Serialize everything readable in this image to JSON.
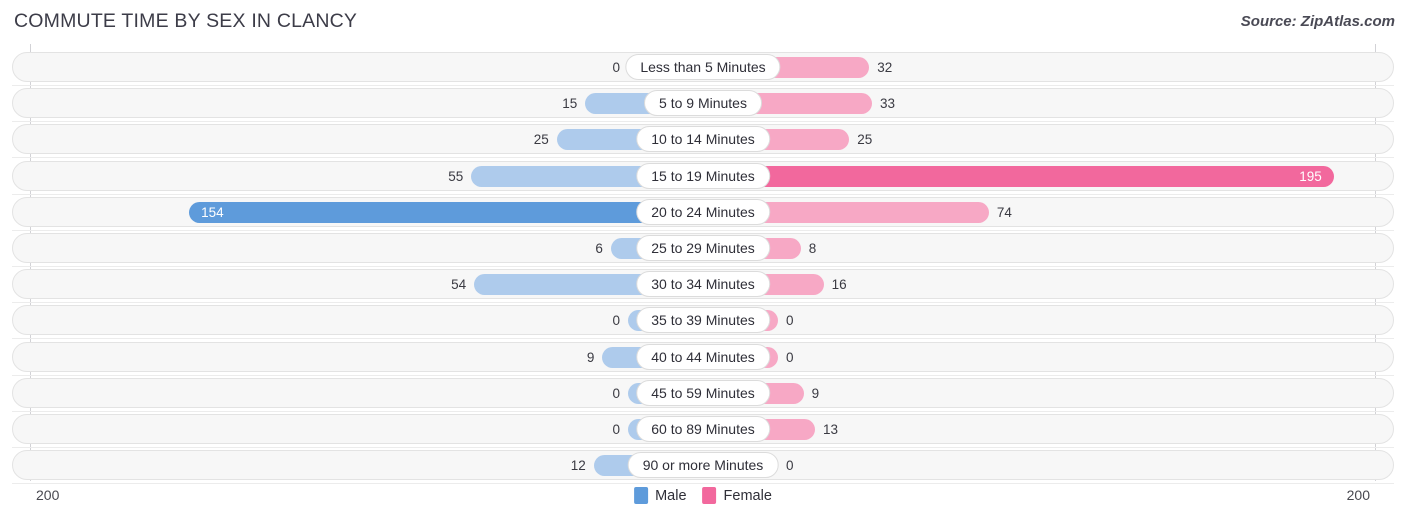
{
  "header": {
    "title": "COMMUTE TIME BY SEX IN CLANCY",
    "source": "Source: ZipAtlas.com"
  },
  "legend": {
    "male_label": "Male",
    "female_label": "Female",
    "male_color": "#5e9bdb",
    "female_color": "#f2689d"
  },
  "axis": {
    "left_tick": "200",
    "right_tick": "200",
    "max": 200
  },
  "colors": {
    "male_light": "#aecbec",
    "male_dark": "#5e9bdb",
    "female_light": "#f7a8c5",
    "female_dark": "#f2689d",
    "track": "#f7f7f7",
    "title": "#3c3c48"
  },
  "chart_data": {
    "type": "bar",
    "title": "COMMUTE TIME BY SEX IN CLANCY",
    "subtitle": "Source: ZipAtlas.com",
    "orientation": "horizontal-diverging",
    "xlabel": "",
    "ylabel": "",
    "xlim": [
      200,
      200
    ],
    "grid": false,
    "legend_position": "bottom-center",
    "categories": [
      "Less than 5 Minutes",
      "5 to 9 Minutes",
      "10 to 14 Minutes",
      "15 to 19 Minutes",
      "20 to 24 Minutes",
      "25 to 29 Minutes",
      "30 to 34 Minutes",
      "35 to 39 Minutes",
      "40 to 44 Minutes",
      "45 to 59 Minutes",
      "60 to 89 Minutes",
      "90 or more Minutes"
    ],
    "series": [
      {
        "name": "Male",
        "side": "left",
        "values": [
          0,
          15,
          25,
          55,
          154,
          6,
          54,
          0,
          9,
          0,
          0,
          12
        ]
      },
      {
        "name": "Female",
        "side": "right",
        "values": [
          32,
          33,
          25,
          195,
          74,
          8,
          16,
          0,
          0,
          9,
          13,
          0
        ]
      }
    ]
  },
  "rows": [
    {
      "label": "Less than 5 Minutes",
      "male": "0",
      "female": "32"
    },
    {
      "label": "5 to 9 Minutes",
      "male": "15",
      "female": "33"
    },
    {
      "label": "10 to 14 Minutes",
      "male": "25",
      "female": "25"
    },
    {
      "label": "15 to 19 Minutes",
      "male": "55",
      "female": "195"
    },
    {
      "label": "20 to 24 Minutes",
      "male": "154",
      "female": "74"
    },
    {
      "label": "25 to 29 Minutes",
      "male": "6",
      "female": "8"
    },
    {
      "label": "30 to 34 Minutes",
      "male": "54",
      "female": "16"
    },
    {
      "label": "35 to 39 Minutes",
      "male": "0",
      "female": "0"
    },
    {
      "label": "40 to 44 Minutes",
      "male": "9",
      "female": "0"
    },
    {
      "label": "45 to 59 Minutes",
      "male": "0",
      "female": "9"
    },
    {
      "label": "60 to 89 Minutes",
      "male": "0",
      "female": "13"
    },
    {
      "label": "90 or more Minutes",
      "male": "12",
      "female": "0"
    }
  ]
}
